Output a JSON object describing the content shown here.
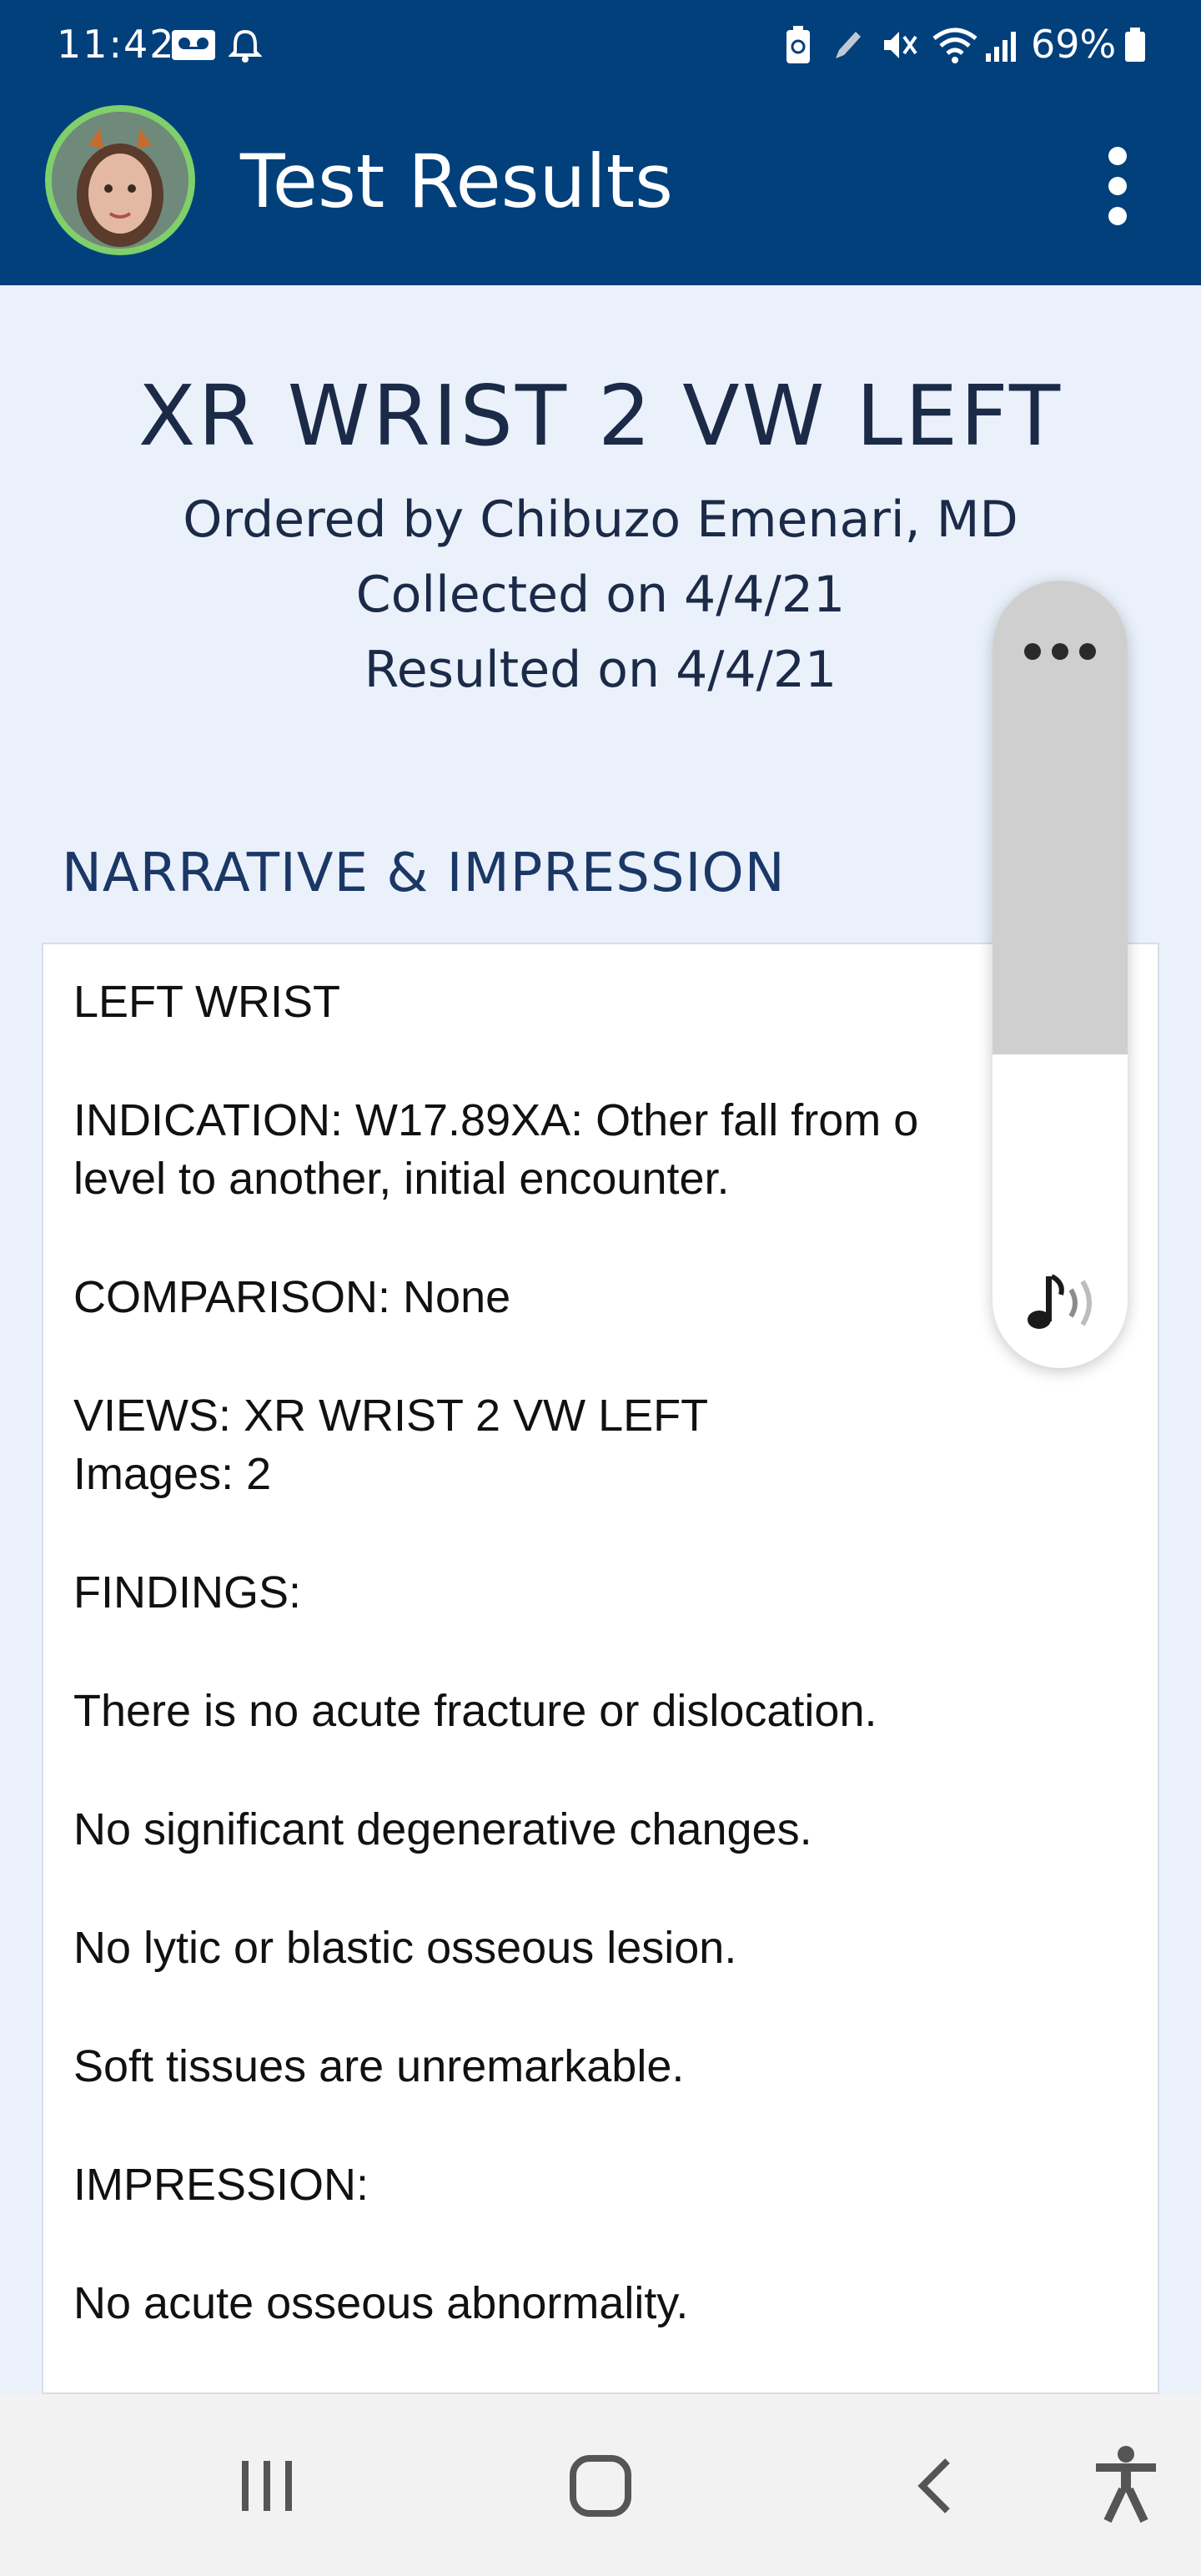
{
  "status_bar": {
    "time": "11:42",
    "battery": "69%"
  },
  "app_bar": {
    "title": "Test Results"
  },
  "result": {
    "title": "XR WRIST 2 VW LEFT",
    "ordered_by": "Ordered by Chibuzo Emenari, MD",
    "collected": "Collected on 4/4/21",
    "resulted": "Resulted on 4/4/21"
  },
  "section": {
    "heading": "NARRATIVE & IMPRESSION"
  },
  "report": {
    "lines": [
      "LEFT WRIST",
      "INDICATION:   W17.89XA: Other fall from o",
      "level to another, initial encounter.",
      "COMPARISON:  None",
      "VIEWS:  XR WRIST 2 VW LEFT",
      "Images: 2",
      "FINDINGS:",
      "There is no acute fracture or dislocation.",
      "No significant degenerative changes.",
      "No lytic or blastic osseous lesion.",
      "Soft tissues are unremarkable.",
      "IMPRESSION:",
      "No acute osseous abnormality."
    ]
  },
  "icons": {
    "status_left": [
      "voicemail-icon",
      "alarm-icon"
    ],
    "status_right": [
      "battery-saver-icon",
      "edit-icon",
      "mute-vibrate-icon",
      "wifi-icon",
      "signal-icon",
      "battery-icon"
    ],
    "app_bar": [
      "avatar",
      "more-vert-icon"
    ],
    "media_panel": [
      "more-horiz-icon",
      "music-volume-icon"
    ],
    "navigation": [
      "recents-icon",
      "home-icon",
      "back-icon",
      "accessibility-icon"
    ]
  },
  "colors": {
    "app_bar": "#02407c",
    "page_background": "#eaf1fb",
    "avatar_ring": "#7fcf6a",
    "heading_text": "#1b2a47"
  }
}
